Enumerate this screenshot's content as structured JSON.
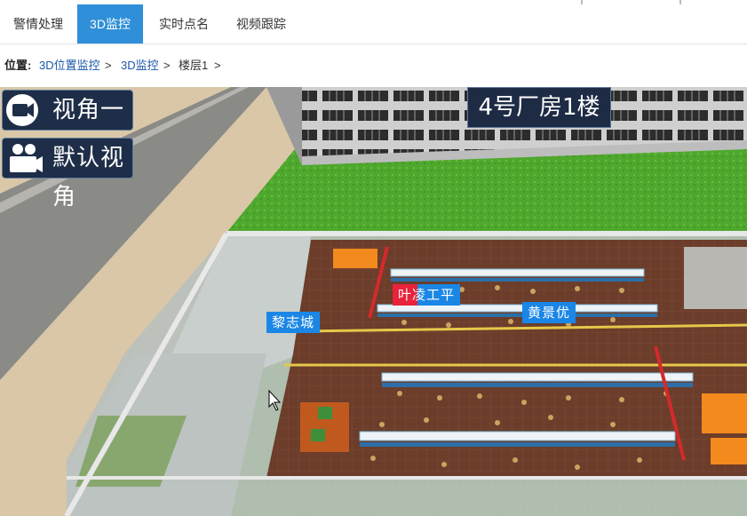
{
  "tabs": [
    {
      "label": "警情处理"
    },
    {
      "label": "3D监控"
    },
    {
      "label": "实时点名"
    },
    {
      "label": "视频跟踪"
    }
  ],
  "breadcrumb": {
    "prefix": "位置:",
    "items": [
      "3D位置监控",
      "3D监控",
      "楼层1"
    ],
    "separator": ">"
  },
  "view_buttons": {
    "view1": "视角一",
    "default_view": "默认视角"
  },
  "building_title": "4号厂房1楼",
  "name_tags": [
    "叶凌工平",
    "黄景优",
    "黎志城"
  ],
  "colors": {
    "tab_active": "#2f8fd8",
    "link": "#1a57a8",
    "tag_bg": "#1a86e6",
    "grass": "#4fa82e",
    "floor": "#6b3d2a"
  }
}
